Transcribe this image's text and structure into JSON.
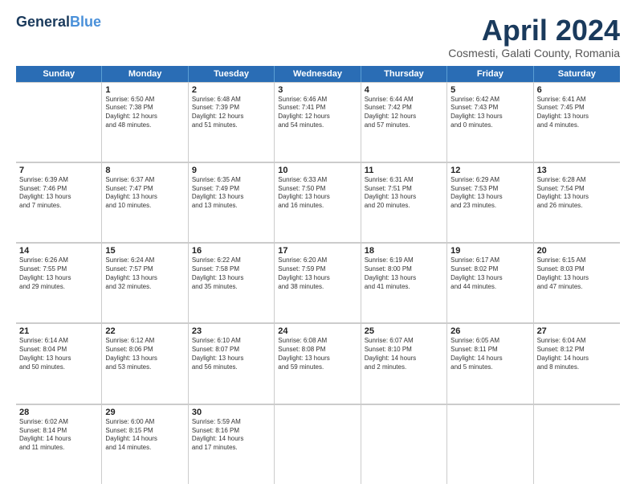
{
  "header": {
    "logo_line1": "General",
    "logo_line2": "Blue",
    "month": "April 2024",
    "location": "Cosmesti, Galati County, Romania"
  },
  "weekdays": [
    "Sunday",
    "Monday",
    "Tuesday",
    "Wednesday",
    "Thursday",
    "Friday",
    "Saturday"
  ],
  "rows": [
    [
      {
        "day": "",
        "lines": []
      },
      {
        "day": "1",
        "lines": [
          "Sunrise: 6:50 AM",
          "Sunset: 7:38 PM",
          "Daylight: 12 hours",
          "and 48 minutes."
        ]
      },
      {
        "day": "2",
        "lines": [
          "Sunrise: 6:48 AM",
          "Sunset: 7:39 PM",
          "Daylight: 12 hours",
          "and 51 minutes."
        ]
      },
      {
        "day": "3",
        "lines": [
          "Sunrise: 6:46 AM",
          "Sunset: 7:41 PM",
          "Daylight: 12 hours",
          "and 54 minutes."
        ]
      },
      {
        "day": "4",
        "lines": [
          "Sunrise: 6:44 AM",
          "Sunset: 7:42 PM",
          "Daylight: 12 hours",
          "and 57 minutes."
        ]
      },
      {
        "day": "5",
        "lines": [
          "Sunrise: 6:42 AM",
          "Sunset: 7:43 PM",
          "Daylight: 13 hours",
          "and 0 minutes."
        ]
      },
      {
        "day": "6",
        "lines": [
          "Sunrise: 6:41 AM",
          "Sunset: 7:45 PM",
          "Daylight: 13 hours",
          "and 4 minutes."
        ]
      }
    ],
    [
      {
        "day": "7",
        "lines": [
          "Sunrise: 6:39 AM",
          "Sunset: 7:46 PM",
          "Daylight: 13 hours",
          "and 7 minutes."
        ]
      },
      {
        "day": "8",
        "lines": [
          "Sunrise: 6:37 AM",
          "Sunset: 7:47 PM",
          "Daylight: 13 hours",
          "and 10 minutes."
        ]
      },
      {
        "day": "9",
        "lines": [
          "Sunrise: 6:35 AM",
          "Sunset: 7:49 PM",
          "Daylight: 13 hours",
          "and 13 minutes."
        ]
      },
      {
        "day": "10",
        "lines": [
          "Sunrise: 6:33 AM",
          "Sunset: 7:50 PM",
          "Daylight: 13 hours",
          "and 16 minutes."
        ]
      },
      {
        "day": "11",
        "lines": [
          "Sunrise: 6:31 AM",
          "Sunset: 7:51 PM",
          "Daylight: 13 hours",
          "and 20 minutes."
        ]
      },
      {
        "day": "12",
        "lines": [
          "Sunrise: 6:29 AM",
          "Sunset: 7:53 PM",
          "Daylight: 13 hours",
          "and 23 minutes."
        ]
      },
      {
        "day": "13",
        "lines": [
          "Sunrise: 6:28 AM",
          "Sunset: 7:54 PM",
          "Daylight: 13 hours",
          "and 26 minutes."
        ]
      }
    ],
    [
      {
        "day": "14",
        "lines": [
          "Sunrise: 6:26 AM",
          "Sunset: 7:55 PM",
          "Daylight: 13 hours",
          "and 29 minutes."
        ]
      },
      {
        "day": "15",
        "lines": [
          "Sunrise: 6:24 AM",
          "Sunset: 7:57 PM",
          "Daylight: 13 hours",
          "and 32 minutes."
        ]
      },
      {
        "day": "16",
        "lines": [
          "Sunrise: 6:22 AM",
          "Sunset: 7:58 PM",
          "Daylight: 13 hours",
          "and 35 minutes."
        ]
      },
      {
        "day": "17",
        "lines": [
          "Sunrise: 6:20 AM",
          "Sunset: 7:59 PM",
          "Daylight: 13 hours",
          "and 38 minutes."
        ]
      },
      {
        "day": "18",
        "lines": [
          "Sunrise: 6:19 AM",
          "Sunset: 8:00 PM",
          "Daylight: 13 hours",
          "and 41 minutes."
        ]
      },
      {
        "day": "19",
        "lines": [
          "Sunrise: 6:17 AM",
          "Sunset: 8:02 PM",
          "Daylight: 13 hours",
          "and 44 minutes."
        ]
      },
      {
        "day": "20",
        "lines": [
          "Sunrise: 6:15 AM",
          "Sunset: 8:03 PM",
          "Daylight: 13 hours",
          "and 47 minutes."
        ]
      }
    ],
    [
      {
        "day": "21",
        "lines": [
          "Sunrise: 6:14 AM",
          "Sunset: 8:04 PM",
          "Daylight: 13 hours",
          "and 50 minutes."
        ]
      },
      {
        "day": "22",
        "lines": [
          "Sunrise: 6:12 AM",
          "Sunset: 8:06 PM",
          "Daylight: 13 hours",
          "and 53 minutes."
        ]
      },
      {
        "day": "23",
        "lines": [
          "Sunrise: 6:10 AM",
          "Sunset: 8:07 PM",
          "Daylight: 13 hours",
          "and 56 minutes."
        ]
      },
      {
        "day": "24",
        "lines": [
          "Sunrise: 6:08 AM",
          "Sunset: 8:08 PM",
          "Daylight: 13 hours",
          "and 59 minutes."
        ]
      },
      {
        "day": "25",
        "lines": [
          "Sunrise: 6:07 AM",
          "Sunset: 8:10 PM",
          "Daylight: 14 hours",
          "and 2 minutes."
        ]
      },
      {
        "day": "26",
        "lines": [
          "Sunrise: 6:05 AM",
          "Sunset: 8:11 PM",
          "Daylight: 14 hours",
          "and 5 minutes."
        ]
      },
      {
        "day": "27",
        "lines": [
          "Sunrise: 6:04 AM",
          "Sunset: 8:12 PM",
          "Daylight: 14 hours",
          "and 8 minutes."
        ]
      }
    ],
    [
      {
        "day": "28",
        "lines": [
          "Sunrise: 6:02 AM",
          "Sunset: 8:14 PM",
          "Daylight: 14 hours",
          "and 11 minutes."
        ]
      },
      {
        "day": "29",
        "lines": [
          "Sunrise: 6:00 AM",
          "Sunset: 8:15 PM",
          "Daylight: 14 hours",
          "and 14 minutes."
        ]
      },
      {
        "day": "30",
        "lines": [
          "Sunrise: 5:59 AM",
          "Sunset: 8:16 PM",
          "Daylight: 14 hours",
          "and 17 minutes."
        ]
      },
      {
        "day": "",
        "lines": []
      },
      {
        "day": "",
        "lines": []
      },
      {
        "day": "",
        "lines": []
      },
      {
        "day": "",
        "lines": []
      }
    ]
  ]
}
